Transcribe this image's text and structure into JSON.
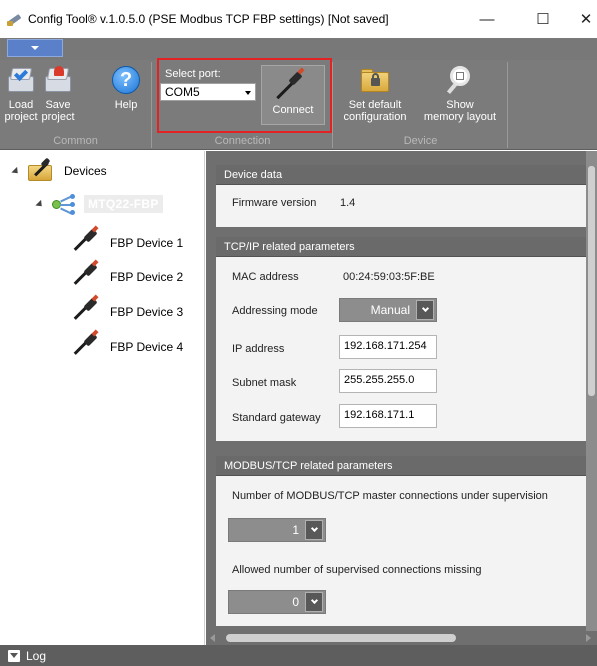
{
  "window": {
    "title": "Config Tool® v.1.0.5.0 (PSE Modbus TCP FBP settings) [Not saved]",
    "minimize_glyph": "—",
    "maximize_glyph": "☐",
    "close_glyph": "✕"
  },
  "ribbon": {
    "groups": {
      "common": "Common",
      "connection": "Connection",
      "device": "Device"
    },
    "buttons": {
      "load_line1": "Load",
      "load_line2": "project",
      "save_line1": "Save",
      "save_line2": "project",
      "help": "Help",
      "connect": "Connect",
      "set_default_line1": "Set default",
      "set_default_line2": "configuration",
      "show_memory_line1": "Show",
      "show_memory_line2": "memory layout"
    },
    "select_port_label": "Select port:",
    "port_value": "COM5",
    "help_glyph": "?"
  },
  "tree": {
    "root": "Devices",
    "controller": "MTQ22-FBP",
    "devices": [
      "FBP Device 1",
      "FBP Device 2",
      "FBP Device 3",
      "FBP Device 4"
    ]
  },
  "device_data": {
    "header": "Device data",
    "firmware_label": "Firmware version",
    "firmware_value": "1.4"
  },
  "tcpip": {
    "header": "TCP/IP related parameters",
    "mac_label": "MAC address",
    "mac_value": "00:24:59:03:5F:BE",
    "addressing_label": "Addressing mode",
    "addressing_value": "Manual",
    "ip_label": "IP address",
    "ip_value": "192.168.171.254",
    "subnet_label": "Subnet mask",
    "subnet_value": "255.255.255.0",
    "gateway_label": "Standard gateway",
    "gateway_value": "192.168.171.1"
  },
  "modbus": {
    "header": "MODBUS/TCP related parameters",
    "master_conn_label": "Number of MODBUS/TCP master connections under supervision",
    "master_conn_value": "1",
    "missing_label": "Allowed number of supervised connections missing",
    "missing_value": "0"
  },
  "log": {
    "label": "Log"
  },
  "colors": {
    "ribbon_bg": "#7b7b7b",
    "content_bg": "#6f6f6f",
    "highlight": "#e32323",
    "app_menu": "#5a80c9"
  }
}
